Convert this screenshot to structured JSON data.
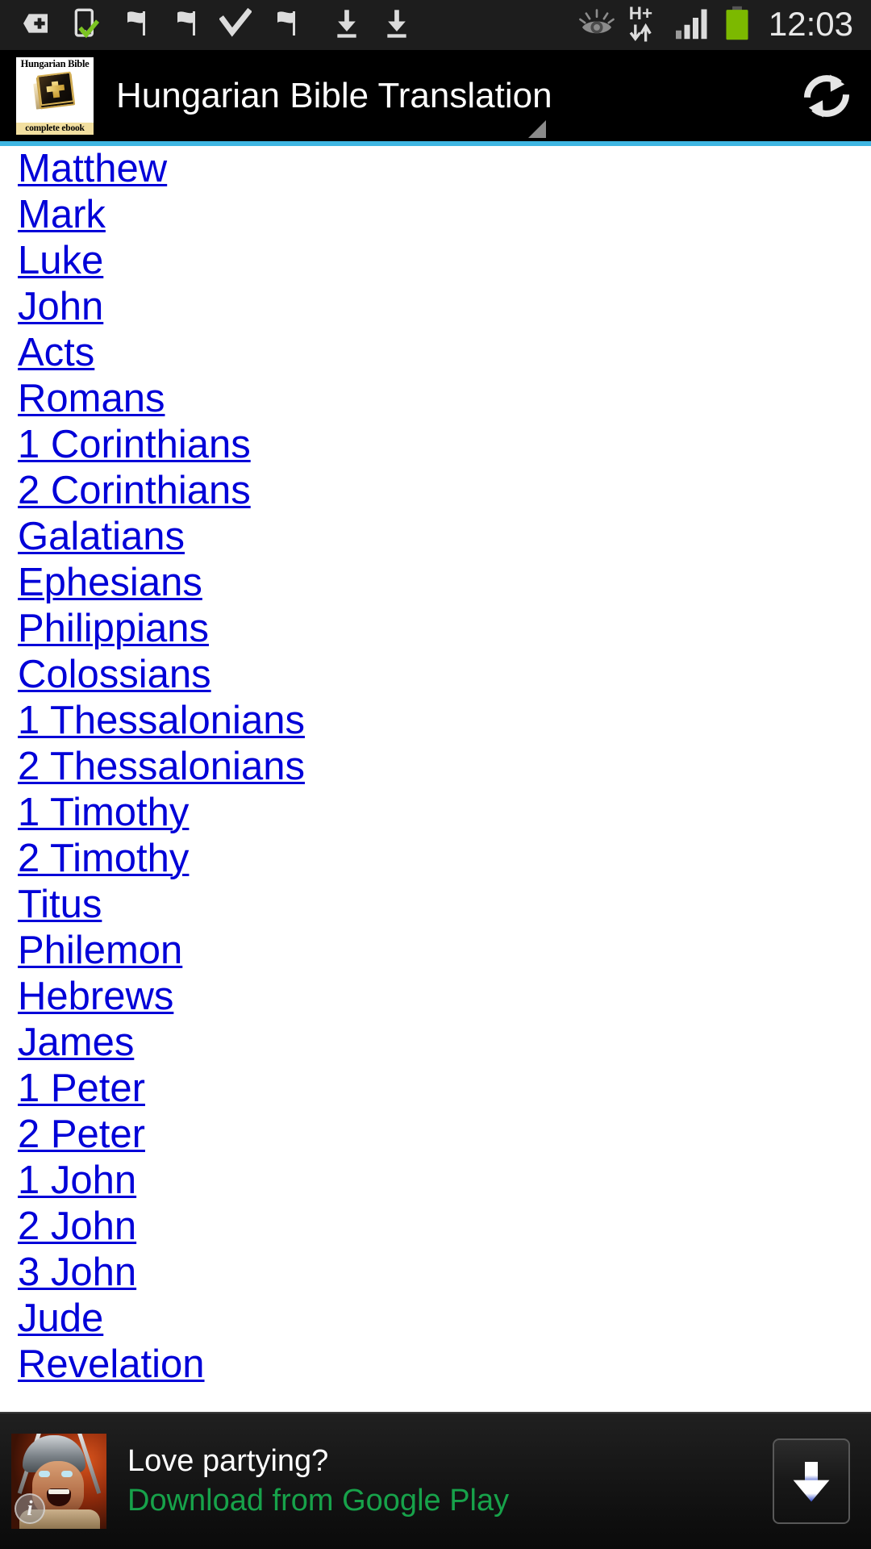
{
  "status_bar": {
    "icons": [
      {
        "name": "sd-card-plus-icon",
        "glyph": "sd-plus"
      },
      {
        "name": "phone-check-icon",
        "glyph": "phone-check"
      },
      {
        "name": "flag-icon-1",
        "glyph": "flag"
      },
      {
        "name": "flag-icon-2",
        "glyph": "flag"
      },
      {
        "name": "checkmark-icon",
        "glyph": "check"
      },
      {
        "name": "flag-icon-3",
        "glyph": "flag"
      },
      {
        "name": "download-icon-1",
        "glyph": "download"
      },
      {
        "name": "download-icon-2",
        "glyph": "download"
      }
    ],
    "right_icons": [
      {
        "name": "smart-stay-eye-icon",
        "glyph": "eye"
      },
      {
        "name": "hsdpa-data-icon",
        "label": "H+"
      },
      {
        "name": "signal-strength-icon",
        "glyph": "signal"
      },
      {
        "name": "battery-icon",
        "glyph": "battery",
        "color": "#7cb900"
      }
    ],
    "clock": "12:03"
  },
  "app_bar": {
    "icon": {
      "title": "Hungarian Bible",
      "subtitle": "complete ebook"
    },
    "title": "Hungarian Bible Translation",
    "refresh_label": "refresh",
    "accent_color": "#3fb6e2"
  },
  "book_list": {
    "link_color": "#0000d8",
    "books": [
      "Matthew",
      "Mark",
      "Luke",
      "John",
      "Acts",
      "Romans",
      "1 Corinthians",
      "2 Corinthians",
      "Galatians",
      "Ephesians",
      "Philippians",
      "Colossians",
      "1 Thessalonians",
      "2 Thessalonians",
      "1 Timothy",
      "2 Timothy",
      "Titus",
      "Philemon",
      "Hebrews",
      "James",
      "1 Peter",
      "2 Peter",
      "1 John",
      "2 John",
      "3 John",
      "Jude",
      "Revelation"
    ]
  },
  "ad_banner": {
    "headline": "Love partying?",
    "subtext": "Download from Google Play",
    "subtext_color": "#17a24a",
    "info_badge": "i",
    "cta_name": "download-arrow"
  }
}
